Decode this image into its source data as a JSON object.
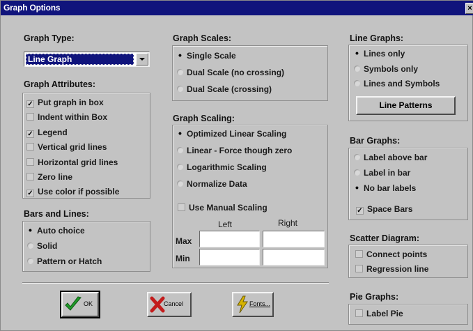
{
  "window": {
    "title": "Graph Options",
    "close_label": "×"
  },
  "graph_type": {
    "label": "Graph Type:",
    "selected": "Line Graph"
  },
  "graph_attributes": {
    "label": "Graph Attributes:",
    "items": [
      {
        "label": "Put graph in box",
        "checked": true
      },
      {
        "label": "Indent within Box",
        "checked": false
      },
      {
        "label": "Legend",
        "checked": true
      },
      {
        "label": "Vertical grid lines",
        "checked": false
      },
      {
        "label": "Horizontal grid lines",
        "checked": false
      },
      {
        "label": "Zero line",
        "checked": false
      },
      {
        "label": "Use color if possible",
        "checked": true
      }
    ]
  },
  "bars_and_lines": {
    "label": "Bars and Lines:",
    "items": [
      {
        "label": "Auto choice",
        "selected": true
      },
      {
        "label": "Solid",
        "selected": false
      },
      {
        "label": "Pattern or Hatch",
        "selected": false
      }
    ]
  },
  "graph_scales": {
    "label": "Graph Scales:",
    "items": [
      {
        "label": "Single Scale",
        "selected": true
      },
      {
        "label": "Dual Scale (no crossing)",
        "selected": false
      },
      {
        "label": "Dual Scale (crossing)",
        "selected": false
      }
    ]
  },
  "graph_scaling": {
    "label": "Graph Scaling:",
    "items": [
      {
        "label": "Optimized Linear Scaling",
        "selected": true
      },
      {
        "label": "Linear - Force though zero",
        "selected": false
      },
      {
        "label": "Logarithmic Scaling",
        "selected": false
      },
      {
        "label": "Normalize Data",
        "selected": false
      }
    ],
    "manual_label": "Use Manual Scaling",
    "left_label": "Left",
    "right_label": "Right",
    "max_label": "Max",
    "min_label": "Min"
  },
  "line_graphs": {
    "label": "Line Graphs:",
    "items": [
      {
        "label": "Lines only",
        "selected": true
      },
      {
        "label": "Symbols only",
        "selected": false
      },
      {
        "label": "Lines and Symbols",
        "selected": false
      }
    ],
    "patterns_button": "Line Patterns"
  },
  "bar_graphs": {
    "label": "Bar Graphs:",
    "items": [
      {
        "label": "Label above bar",
        "selected": false
      },
      {
        "label": "Label in bar",
        "selected": false
      },
      {
        "label": "No bar labels",
        "selected": true
      }
    ],
    "space_bars": "Space Bars"
  },
  "scatter": {
    "label": "Scatter Diagram:",
    "items": [
      {
        "label": "Connect points"
      },
      {
        "label": "Regression line"
      }
    ]
  },
  "pie": {
    "label": "Pie Graphs:",
    "item": "Label Pie"
  },
  "buttons": {
    "ok": "OK",
    "cancel": "Cancel",
    "fonts": "Fonts..."
  },
  "colors": {
    "title_bar": "#10147c",
    "dialog_face": "#c3c3c3",
    "ok_check": "#1f9a28",
    "cancel_x": "#c31d1d",
    "fonts_icon": "#d7b400"
  },
  "icons": {
    "ok": "check-icon",
    "cancel": "red-x-icon",
    "fonts": "lightning-icon",
    "dropdown": "chevron-down-icon"
  }
}
